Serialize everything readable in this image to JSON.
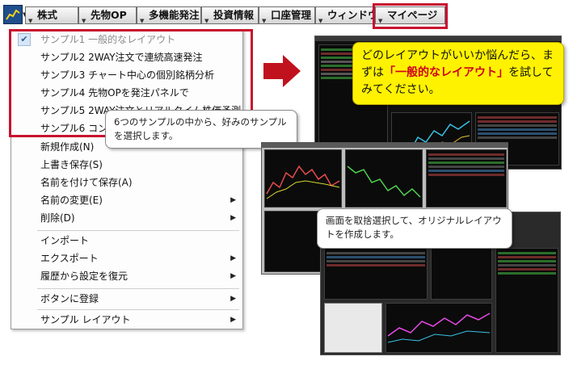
{
  "toolbar": {
    "buttons": [
      {
        "label": "株式"
      },
      {
        "label": "先物OP"
      },
      {
        "label": "多機能発注"
      },
      {
        "label": "投資情報"
      },
      {
        "label": "口座管理"
      },
      {
        "label": "ウィンドウ"
      },
      {
        "label": "マイページ"
      }
    ]
  },
  "menu": {
    "samples": [
      {
        "label": "サンプル1  一般的なレイアウト",
        "checked": true,
        "disabled": true
      },
      {
        "label": "サンプル2  2WAY注文で連続高速発注"
      },
      {
        "label": "サンプル3  チャート中心の個別銘柄分析"
      },
      {
        "label": "サンプル4  先物OPを発注パネルで"
      },
      {
        "label": "サンプル5  2WAY注文とリアルタイム株価予測"
      },
      {
        "label": "サンプル6  コン"
      }
    ],
    "items": [
      {
        "label": "新規作成(N)"
      },
      {
        "label": "上書き保存(S)"
      },
      {
        "label": "名前を付けて保存(A)"
      },
      {
        "label": "名前の変更(E)"
      },
      {
        "label": "削除(D)"
      },
      {
        "label": "インポート"
      },
      {
        "label": "エクスポート"
      },
      {
        "label": "履歴から設定を復元"
      },
      {
        "label": "ボタンに登録"
      },
      {
        "label": "サンプル レイアウト"
      }
    ]
  },
  "callouts": {
    "select_sample": "6つのサンプルの中から、好みのサンプルを選択します。",
    "yellow_pre": "どのレイアウトがいいか悩んだら、まずは",
    "yellow_highlight": "「一般的なレイアウト」",
    "yellow_post": "を試してみてください。",
    "original_layout": "画面を取捨選択して、オリジナルレイアウトを作成します。"
  },
  "colors": {
    "highlight_red": "#c8102e",
    "callout_yellow": "#fff200",
    "arrow_red": "#c0121e"
  }
}
